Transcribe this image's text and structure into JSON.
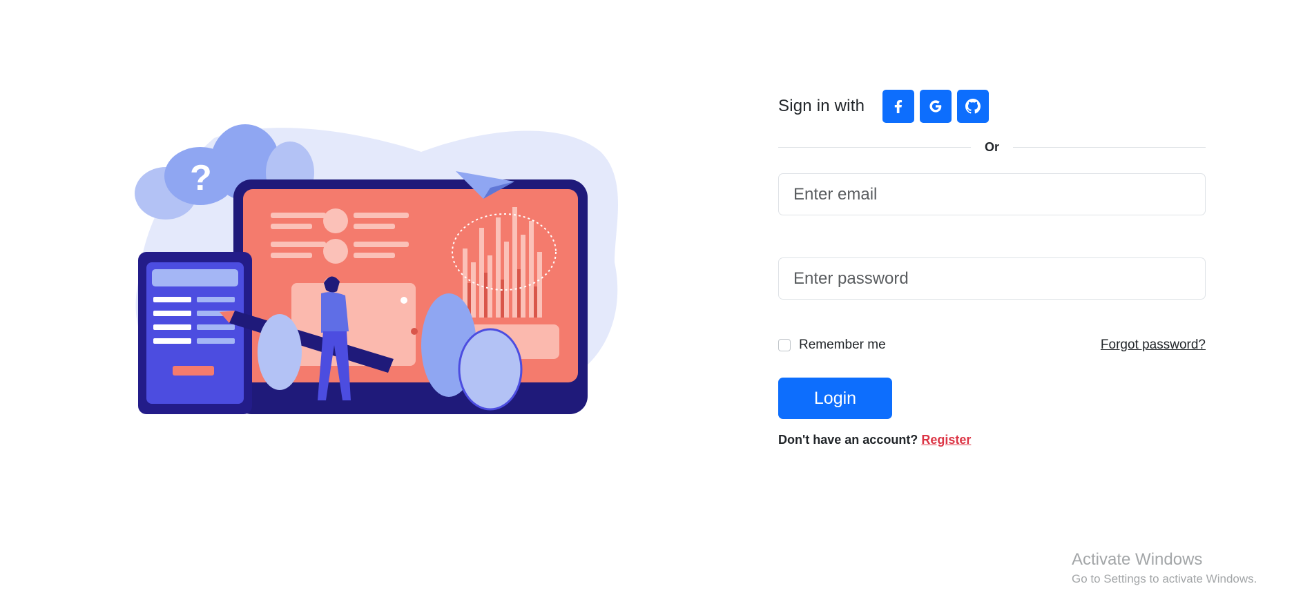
{
  "illustration": {
    "name": "login-illustration",
    "question_glyph": "?",
    "colors": {
      "screen_frame": "#1f1a7a",
      "screen_fill": "#f47b6d",
      "bubble_blue": "#8fa6f2",
      "backdrop": "#e4e9fb",
      "phone_frame": "#231c89",
      "phone_screen": "#4c4de0"
    }
  },
  "social": {
    "label": "Sign in with",
    "buttons": [
      {
        "name": "facebook",
        "icon": "facebook-icon"
      },
      {
        "name": "google",
        "icon": "google-icon"
      },
      {
        "name": "github",
        "icon": "github-icon"
      }
    ],
    "button_color": "#0d6efd"
  },
  "divider": {
    "text": "Or"
  },
  "form": {
    "email": {
      "placeholder": "Enter email",
      "value": ""
    },
    "password": {
      "placeholder": "Enter password",
      "value": ""
    },
    "remember_label": "Remember me",
    "remember_checked": false,
    "forgot_label": "Forgot password?",
    "login_label": "Login",
    "register_prompt": "Don't have an account?",
    "register_label": "Register"
  },
  "watermark": {
    "title": "Activate Windows",
    "subtitle": "Go to Settings to activate Windows."
  }
}
